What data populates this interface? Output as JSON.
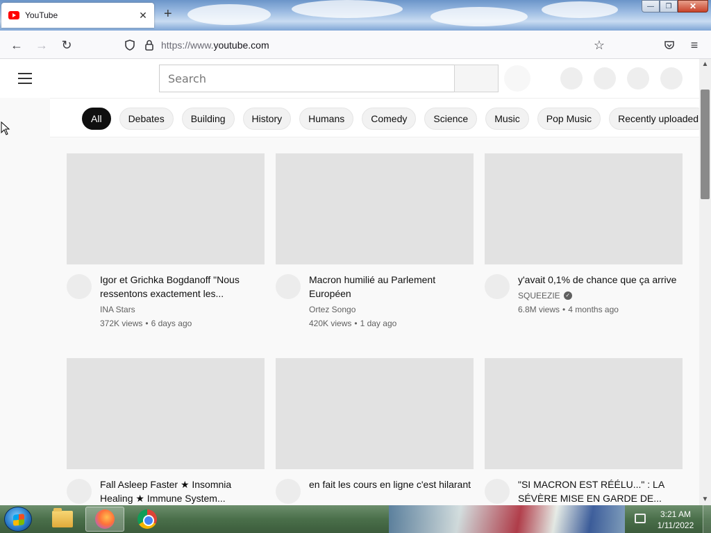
{
  "browser": {
    "tab": {
      "title": "YouTube",
      "close_glyph": "✕"
    },
    "new_tab_glyph": "+",
    "url": {
      "prefix": "https://www.",
      "domain": "youtube.com"
    },
    "window_controls": {
      "minimize": "—",
      "maximize": "❐",
      "close": "✕"
    },
    "nav": {
      "back": "←",
      "forward": "→",
      "reload": "↻",
      "star": "☆",
      "menu": "≡"
    }
  },
  "youtube": {
    "search_placeholder": "Search",
    "chips": [
      "All",
      "Debates",
      "Building",
      "History",
      "Humans",
      "Comedy",
      "Science",
      "Music",
      "Pop Music",
      "Recently uploaded"
    ],
    "active_chip": "All",
    "videos": [
      {
        "title": "Igor et Grichka Bogdanoff \"Nous ressentons exactement les...",
        "channel": "INA Stars",
        "verified": false,
        "views": "372K views",
        "age": "6 days ago"
      },
      {
        "title": "Macron humilié au Parlement Européen",
        "channel": "Ortez Songo",
        "verified": false,
        "views": "420K views",
        "age": "1 day ago"
      },
      {
        "title": "y'avait 0,1% de chance que ça arrive",
        "channel": "SQUEEZIE",
        "verified": true,
        "views": "6.8M views",
        "age": "4 months ago"
      },
      {
        "title": "Fall Asleep Faster ★ Insomnia Healing ★ Immune System...",
        "channel": "",
        "verified": false,
        "views": "",
        "age": ""
      },
      {
        "title": "en fait les cours en ligne c'est hilarant",
        "channel": "",
        "verified": false,
        "views": "",
        "age": ""
      },
      {
        "title": "\"SI MACRON EST RÉÉLU...\" : LA SÉVÈRE MISE EN GARDE DE...",
        "channel": "",
        "verified": false,
        "views": "",
        "age": ""
      }
    ],
    "separator": "•",
    "verified_glyph": "✓"
  },
  "scrollbar": {
    "up": "▲",
    "down": "▼"
  },
  "taskbar": {
    "time": "3:21 AM",
    "date": "1/11/2022"
  },
  "colors": {
    "accent": "#ff0000",
    "chip_active": "#0f0f0f",
    "thumb_placeholder": "#e2e2e2"
  }
}
